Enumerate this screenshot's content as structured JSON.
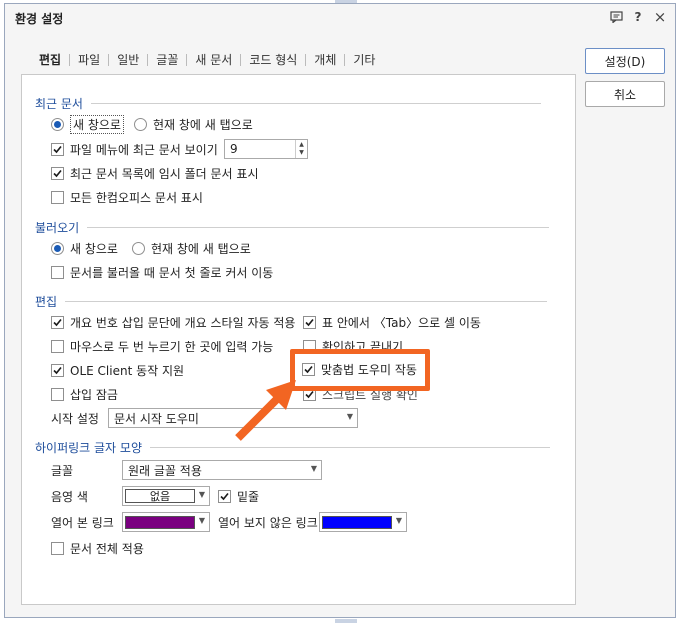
{
  "window": {
    "title": "환경 설정",
    "help_label": "?",
    "close_label": "×"
  },
  "tabs": [
    {
      "label": "편집",
      "active": true
    },
    {
      "label": "파일"
    },
    {
      "label": "일반"
    },
    {
      "label": "글꼴"
    },
    {
      "label": "새 문서"
    },
    {
      "label": "코드 형식"
    },
    {
      "label": "개체"
    },
    {
      "label": "기타"
    }
  ],
  "buttons": {
    "ok": "설정(D)",
    "cancel": "취소"
  },
  "recent": {
    "heading": "최근 문서",
    "radio_new_window": "새 창으로",
    "radio_new_tab": "현재 창에 새 탭으로",
    "show_recent_in_menu": "파일 메뉴에 최근 문서 보이기",
    "recent_count": "9",
    "show_temp_folder": "최근 문서 목록에 임시 폴더 문서 표시",
    "show_all_hancom": "모든 한컴오피스 문서 표시"
  },
  "open": {
    "heading": "불러오기",
    "radio_new_window": "새 창으로",
    "radio_new_tab": "현재 창에 새 탭으로",
    "cursor_first_line": "문서를 불러올 때 문서 첫 줄로 커서 이동"
  },
  "edit": {
    "heading": "편집",
    "outline_style": "개요 번호 삽입 문단에 개요 스타일 자동 적용",
    "tab_in_table": "표 안에서 〈Tab〉으로 셀 이동",
    "mouse_double_click": "마우스로 두 번 누르기 한 곳에 입력 가능",
    "confirm_exit": "확인하고 끝내기",
    "ole_client": "OLE Client 동작 지원",
    "spelling_helper": "맞춤법 도우미 작동",
    "insert_lock": "삽입 잠금",
    "script_check": "스크립트 실행 확인",
    "start_setting_label": "시작 설정",
    "start_setting_value": "문서 시작 도우미"
  },
  "hyperlink": {
    "heading": "하이퍼링크 글자 모양",
    "font_label": "글꼴",
    "font_value": "원래 글꼴 적용",
    "shade_label": "음영 색",
    "shade_value": "없음",
    "underline": "밑줄",
    "visited_label": "열어 본 링크",
    "visited_color": "#7a0080",
    "unvisited_label": "열어 보지 않은 링크",
    "unvisited_color": "#0000ff",
    "apply_whole_doc": "문서 전체 적용"
  },
  "colors": {
    "accent": "#1e4d9b",
    "highlight": "#f26522",
    "radio_on": "#1b5bb5"
  }
}
